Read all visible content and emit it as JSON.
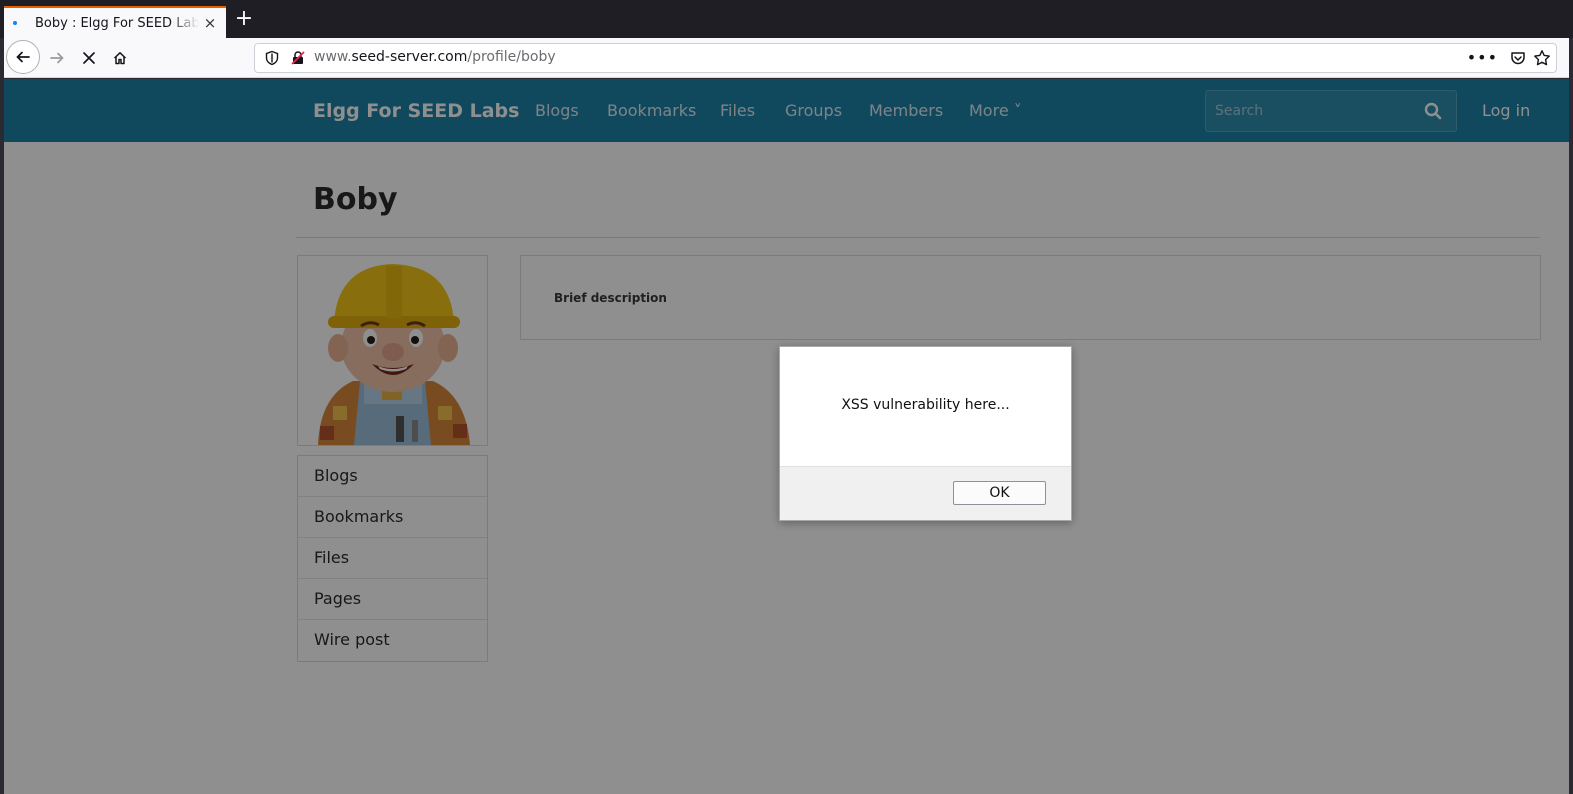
{
  "browser": {
    "tab_title": "Boby : Elgg For SEED Labs",
    "new_tab_label": "+",
    "tab_close": "×",
    "url_prefix": "www.",
    "url_host": "seed-server.com",
    "url_path": "/profile/boby",
    "more_label": "•••"
  },
  "site": {
    "title": "Elgg For SEED Labs",
    "menu": [
      "Blogs",
      "Bookmarks",
      "Files",
      "Groups",
      "Members",
      "More ˅"
    ],
    "search_placeholder": "Search",
    "login_label": "Log in",
    "accent_color": "#1e83a8"
  },
  "profile": {
    "name": "Boby",
    "brief_description_label": "Brief description",
    "owner_menu": [
      "Blogs",
      "Bookmarks",
      "Files",
      "Pages",
      "Wire post"
    ]
  },
  "dialog": {
    "message": "XSS vulnerability here...",
    "ok_label": "OK"
  }
}
